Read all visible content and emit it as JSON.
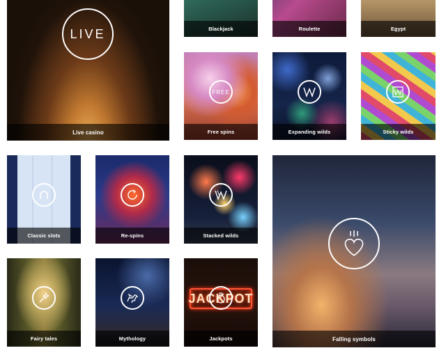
{
  "tiles": {
    "blackjack": {
      "label": "Blackjack"
    },
    "roulette": {
      "label": "Roulette"
    },
    "egypt": {
      "label": "Egypt"
    },
    "live_casino": {
      "label": "Live casino",
      "icon_text": "LIVE"
    },
    "free_spins": {
      "label": "Free spins",
      "icon_text": "FREE"
    },
    "expanding_wilds": {
      "label": "Expanding wilds"
    },
    "sticky_wilds": {
      "label": "Sticky wilds"
    },
    "classic_slots": {
      "label": "Classic slots"
    },
    "re_spins": {
      "label": "Re-spins"
    },
    "stacked_wilds": {
      "label": "Stacked wilds"
    },
    "falling_symbols": {
      "label": "Falling symbols"
    },
    "fairy_tales": {
      "label": "Fairy tales"
    },
    "mythology": {
      "label": "Mythology"
    },
    "jackpots": {
      "label": "Jackpots",
      "neon_text": "JACKPOT"
    }
  },
  "icons": {
    "live_casino": "live-icon",
    "free_spins": "free-spins-icon",
    "expanding_wilds": "wild-w-icon",
    "sticky_wilds": "sticky-wild-icon",
    "classic_slots": "horseshoe-icon",
    "re_spins": "respin-arrow-icon",
    "stacked_wilds": "stacked-w-icon",
    "falling_symbols": "falling-heart-icon",
    "fairy_tales": "magic-wand-icon",
    "mythology": "pegasus-icon",
    "jackpots": "jackpot-bag-icon"
  },
  "colors": {
    "label_bar": "#000000",
    "label_text": "#ffffff",
    "neon_frame": "#ff5a3a"
  }
}
